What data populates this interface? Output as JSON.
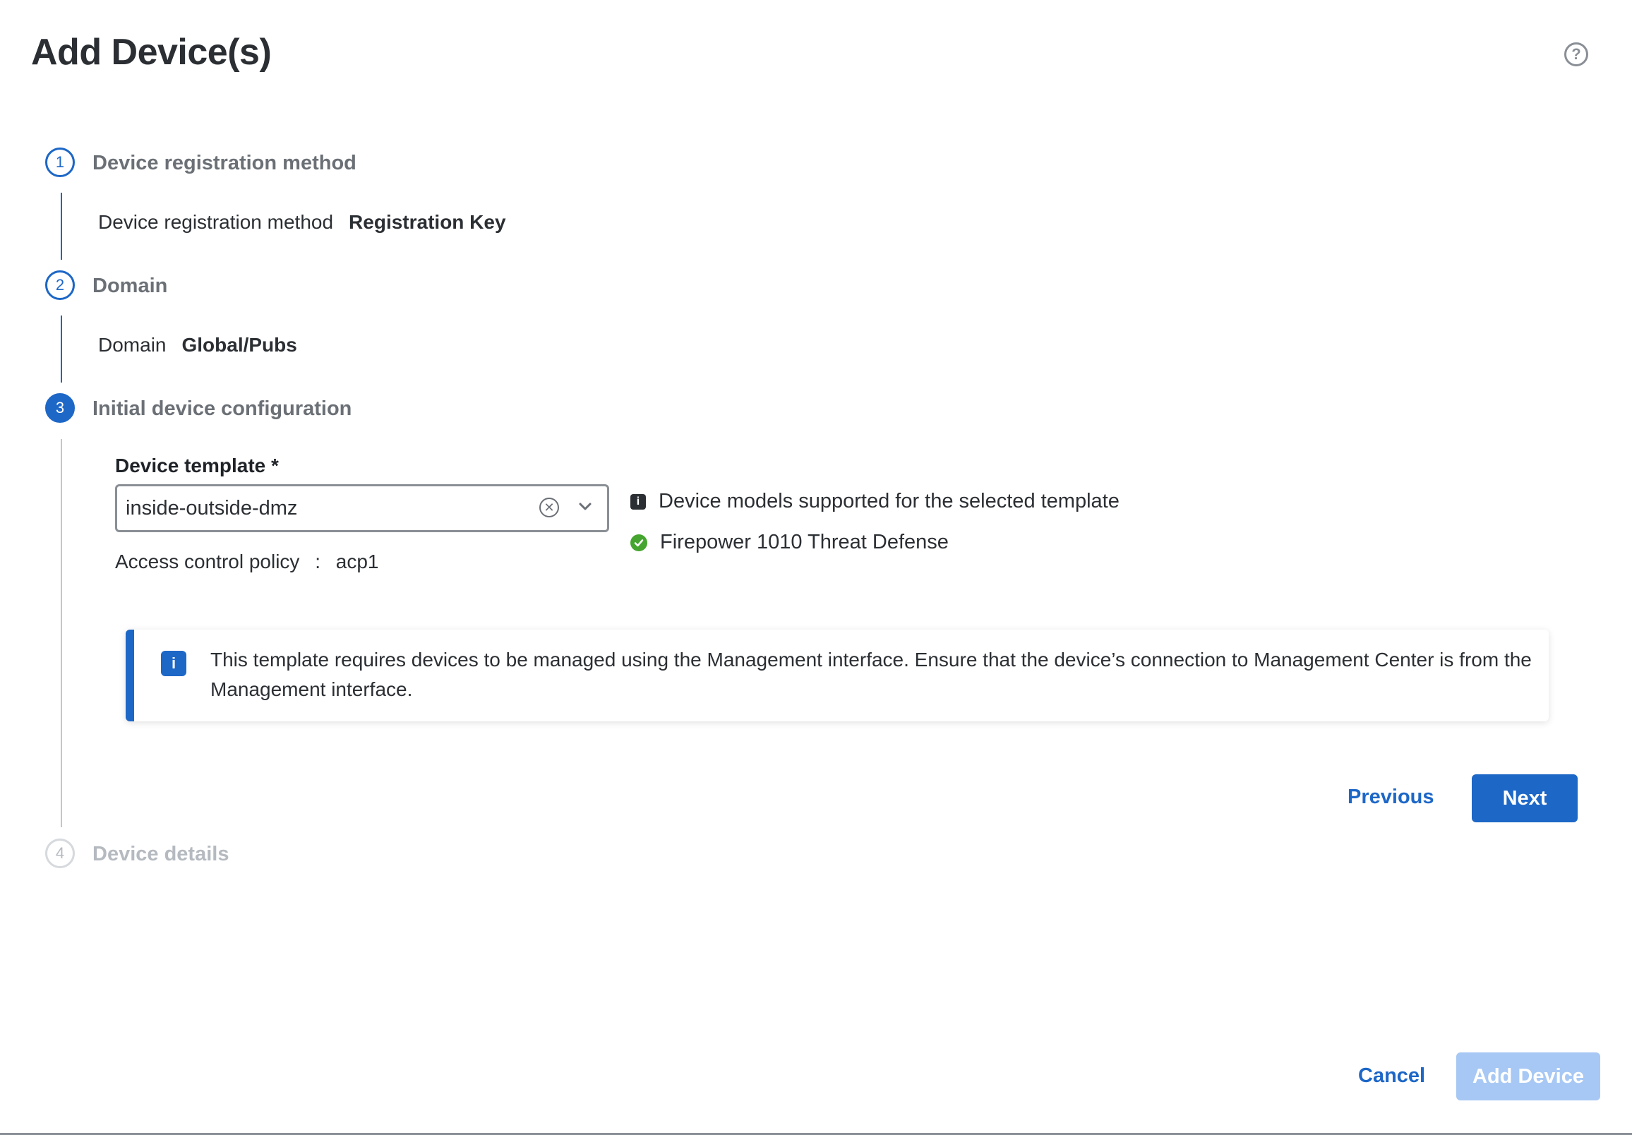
{
  "dialog": {
    "title": "Add Device(s)",
    "help_icon": "question-circle-icon",
    "help_glyph": "?"
  },
  "steps": [
    {
      "number": "1",
      "title": "Device registration method",
      "state": "completed",
      "summary_label": "Device registration method",
      "summary_value": "Registration Key"
    },
    {
      "number": "2",
      "title": "Domain",
      "state": "completed",
      "summary_label": "Domain",
      "summary_value": "Global/Pubs"
    },
    {
      "number": "3",
      "title": "Initial device configuration",
      "state": "active"
    },
    {
      "number": "4",
      "title": "Device details",
      "state": "disabled"
    }
  ],
  "config": {
    "device_template_label": "Device template *",
    "device_template_value": "inside-outside-dmz",
    "access_policy_label": "Access control policy",
    "access_policy_sep": ":",
    "access_policy_value": "acp1",
    "models_header": "Device models supported for the selected template",
    "models": [
      "Firepower 1010 Threat Defense"
    ],
    "banner_text": "This template requires devices to be managed using the Management interface. Ensure that the device’s connection to Management Center is from the Management interface."
  },
  "step_actions": {
    "previous_label": "Previous",
    "next_label": "Next"
  },
  "footer": {
    "cancel_label": "Cancel",
    "add_device_label": "Add Device"
  },
  "colors": {
    "accent": "#1d67c7",
    "success": "#45a52f",
    "disabled_primary": "#a7c8f4"
  }
}
